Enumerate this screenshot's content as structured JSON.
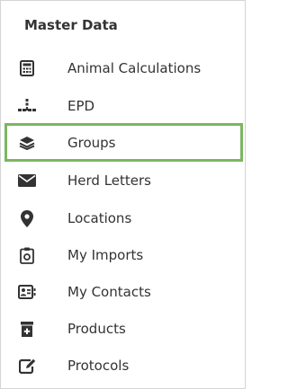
{
  "sidebar": {
    "header": "Master Data",
    "selected_border_color": "#7bb661",
    "items": [
      {
        "label": "Animal Calculations",
        "icon": "calculator-icon"
      },
      {
        "label": "EPD",
        "icon": "epd-icon"
      },
      {
        "label": "Groups",
        "icon": "layers-icon",
        "selected": true
      },
      {
        "label": "Herd Letters",
        "icon": "envelope-icon"
      },
      {
        "label": "Locations",
        "icon": "map-marker-icon"
      },
      {
        "label": "My Imports",
        "icon": "import-clipboard-icon"
      },
      {
        "label": "My Contacts",
        "icon": "contact-card-icon"
      },
      {
        "label": "Products",
        "icon": "product-box-icon"
      },
      {
        "label": "Protocols",
        "icon": "edit-icon"
      }
    ]
  }
}
